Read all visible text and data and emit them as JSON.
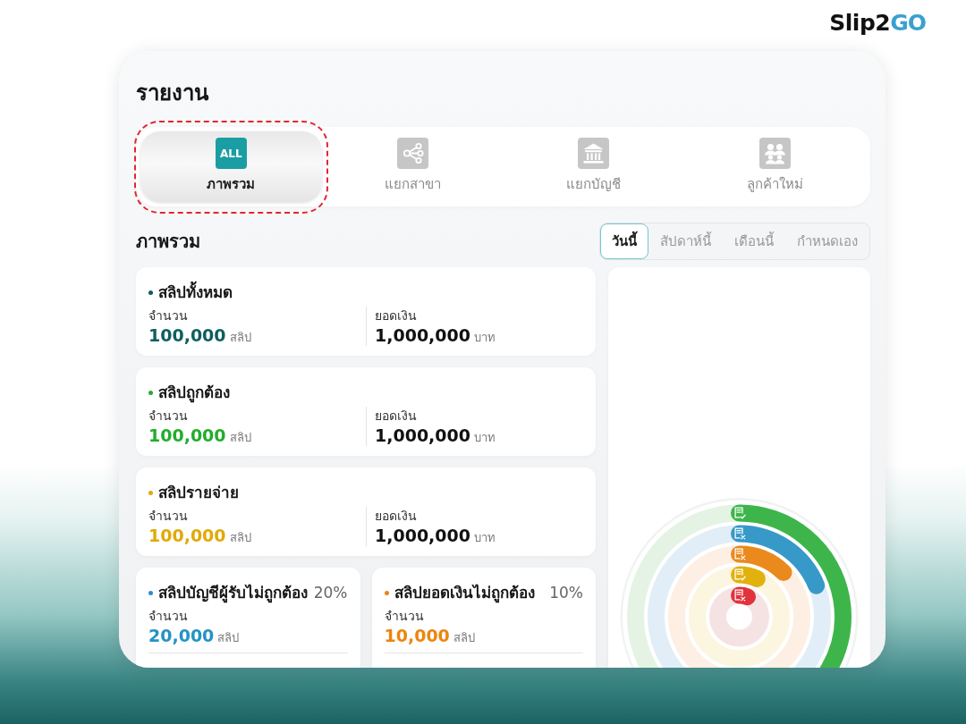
{
  "logo": {
    "text": "Slip2",
    "mark": "GO"
  },
  "page_title": "รายงาน",
  "tabs": [
    {
      "label": "ภาพรวม",
      "badge": "ALL",
      "selected": true,
      "highlighted": true
    },
    {
      "label": "แยกสาขา",
      "selected": false,
      "highlighted": false
    },
    {
      "label": "แยกบัญชี",
      "selected": false,
      "highlighted": false
    },
    {
      "label": "ลูกค้าใหม่",
      "selected": false,
      "highlighted": false
    }
  ],
  "overview": {
    "title": "ภาพรวม",
    "period_tabs": [
      {
        "label": "วันนี้",
        "selected": true
      },
      {
        "label": "สัปดาห์นี้",
        "selected": false
      },
      {
        "label": "เดือนนี้",
        "selected": false
      },
      {
        "label": "กำหนดเอง",
        "selected": false
      }
    ],
    "summary_cards": [
      {
        "title": "สลิปทั้งหมด",
        "color": "#0f5f5f",
        "count_label": "จำนวน",
        "count": "100,000",
        "count_unit": "สลิป",
        "amount_label": "ยอดเงิน",
        "amount": "1,000,000",
        "amount_unit": "บาท"
      },
      {
        "title": "สลิปถูกต้อง",
        "color": "#22ad2e",
        "count_label": "จำนวน",
        "count": "100,000",
        "count_unit": "สลิป",
        "amount_label": "ยอดเงิน",
        "amount": "1,000,000",
        "amount_unit": "บาท"
      },
      {
        "title": "สลิปรายจ่าย",
        "color": "#e2a908",
        "count_label": "จำนวน",
        "count": "100,000",
        "count_unit": "สลิป",
        "amount_label": "ยอดเงิน",
        "amount": "1,000,000",
        "amount_unit": "บาท"
      }
    ],
    "issue_cards": [
      {
        "title": "สลิปบัญชีผู้รับไม่ถูกต้อง",
        "percent": "20%",
        "color": "#2493c6",
        "count_label": "จำนวน",
        "count": "20,000",
        "count_unit": "สลิป"
      },
      {
        "title": "สลิปยอดเงินไม่ถูกต้อง",
        "percent": "10%",
        "color": "#ed850f",
        "count_label": "จำนวน",
        "count": "10,000",
        "count_unit": "สลิป"
      }
    ],
    "chart": {
      "kind": "radial-bars"
    }
  }
}
